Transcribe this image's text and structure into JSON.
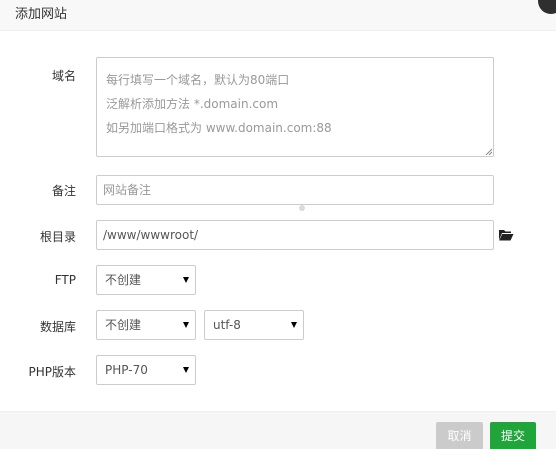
{
  "dialog": {
    "title": "添加网站"
  },
  "form": {
    "domain": {
      "label": "域名",
      "placeholder_lines": [
        "每行填写一个域名，默认为80端口",
        "泛解析添加方法 *.domain.com",
        "如另加端口格式为 www.domain.com:88"
      ]
    },
    "remark": {
      "label": "备注",
      "placeholder": "网站备注"
    },
    "root_dir": {
      "label": "根目录",
      "value": "/www/wwwroot/"
    },
    "ftp": {
      "label": "FTP",
      "selected": "不创建"
    },
    "database": {
      "label": "数据库",
      "selected": "不创建",
      "charset": "utf-8"
    },
    "php": {
      "label": "PHP版本",
      "selected": "PHP-70"
    }
  },
  "footer": {
    "cancel_label": "取消",
    "submit_label": "提交"
  },
  "colors": {
    "submit": "#20a53a",
    "cancel": "#cbcbcb",
    "border": "#cccccc"
  },
  "icons": {
    "close": "close-icon",
    "folder": "folder-open-icon",
    "dropdown": "caret-down-icon"
  }
}
